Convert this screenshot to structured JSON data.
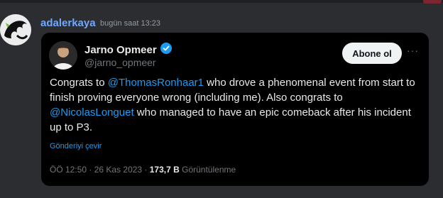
{
  "message": {
    "username": "adalerkaya",
    "timestamp": "bugün saat 13:23"
  },
  "tweet": {
    "author_name": "Jarno Opmeer",
    "author_handle": "@jarno_opmeer",
    "follow_label": "Abone ol",
    "more_label": "···",
    "text_segments": [
      "Congrats to ",
      "@ThomasRonhaar1",
      " who drove a phenomenal event from start to finish proving everyone wrong (including me). Also congrats to ",
      "@NicolasLonguet",
      " who managed to have an epic comeback after his incident up to P3."
    ],
    "translate_label": "Gönderiyi çevir",
    "time": "ÖÖ 12:50 · 26 Kas 2023 · ",
    "views_count": "173,7 B",
    "views_label": "Görüntülenme",
    "verified_color": "#1d9bf0"
  }
}
